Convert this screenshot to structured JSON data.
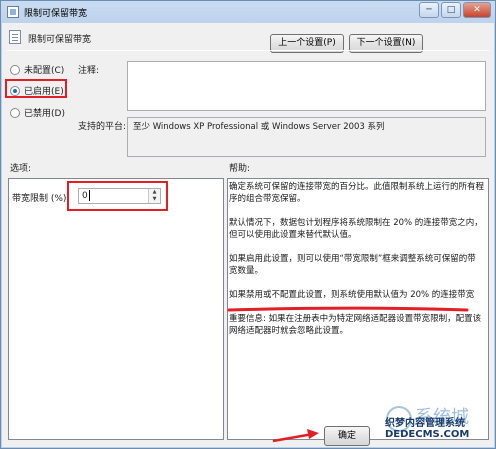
{
  "window": {
    "title": "限制可保留带宽",
    "minimize": "─",
    "maximize": "□",
    "close": "✕"
  },
  "header": {
    "title": "限制可保留带宽",
    "prev_button": "上一个设置(P)",
    "next_button": "下一个设置(N)"
  },
  "state_options": [
    {
      "label": "未配置(C)",
      "checked": false
    },
    {
      "label": "已启用(E)",
      "checked": true
    },
    {
      "label": "已禁用(D)",
      "checked": false
    }
  ],
  "comment": {
    "label": "注释:",
    "value": ""
  },
  "platform": {
    "label": "支持的平台:",
    "value": "至少 Windows XP Professional 或 Windows Server 2003 系列"
  },
  "options": {
    "section_label": "选项:",
    "bandwidth_label": "带宽限制 (%):",
    "bandwidth_value": "0"
  },
  "help": {
    "section_label": "帮助:",
    "paragraphs": [
      "确定系统可保留的连接带宽的百分比。此值限制系统上运行的所有程序的组合带宽保留。",
      "默认情况下，数据包计划程序将系统限制在 20% 的连接带宽之内，但可以使用此设置来替代默认值。",
      "如果启用此设置，则可以使用“带宽限制”框来调整系统可保留的带宽数量。",
      "如果禁用或不配置此设置，则系统使用默认值为 20% 的连接带宽",
      "重要信息: 如果在注册表中为特定网络适配器设置带宽限制，配置该网络适配器时就会忽略此设置。"
    ]
  },
  "footer": {
    "ok_button": "确定"
  },
  "watermark": {
    "logo_text": "系统城",
    "site_name": "织梦内容管理系统",
    "domain": "DEDECMS.COM"
  },
  "colors": {
    "annotation_red": "#e21f26",
    "title_bar": "#b9d1ea"
  }
}
